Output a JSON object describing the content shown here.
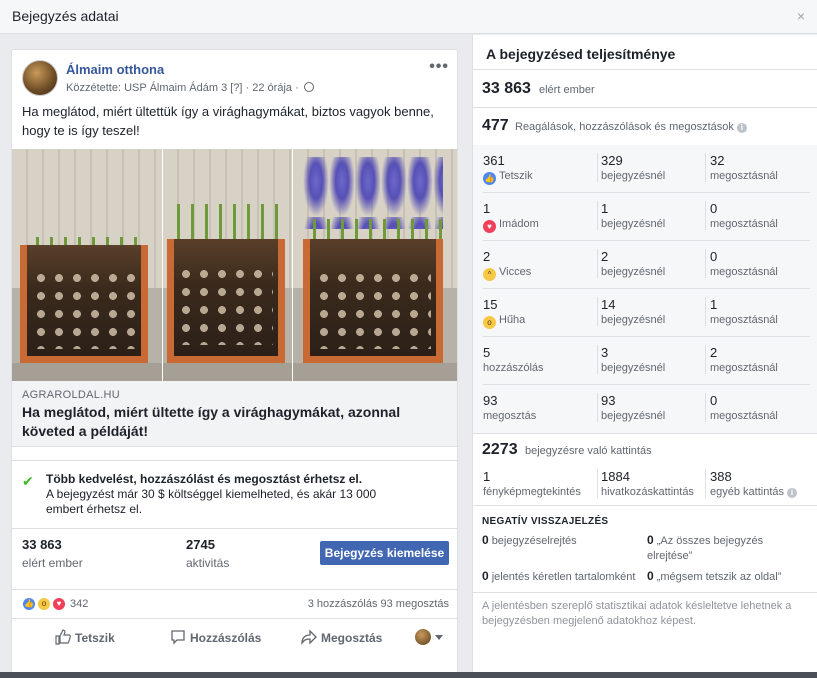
{
  "dialog": {
    "title": "Bejegyzés adatai",
    "close_glyph": "×"
  },
  "post": {
    "page_name": "Álmaim otthona",
    "meta": "Közzétette: USP Álmaim Ádám 3 [?] · 22 órája ·",
    "text": "Ha meglátod, miért ültettük így a virághagymákat, biztos vagyok benne, hogy te is így teszel!",
    "link_domain": "AGRAROLDAL.HU",
    "link_title": "Ha meglátod, miért ültette így a virághagymákat, azonnal követed a példáját!",
    "boost_title": "Több kedvelést, hozzászólást és megosztást érhetsz el.",
    "boost_desc": "A bejegyzést már 30 $ költséggel kiemelheted, és akár 13 000 embert érhetsz el.",
    "reach_value": "33 863",
    "reach_label": "elért ember",
    "activity_value": "2745",
    "activity_label": "aktivitás",
    "boost_button": "Bejegyzés kiemelése",
    "reaction_count": "342",
    "comments_shares": "3 hozzászólás  93 megosztás",
    "actions": {
      "like": "Tetszik",
      "comment": "Hozzászólás",
      "share": "Megosztás"
    }
  },
  "panel": {
    "title": "A bejegyzésed teljesítménye",
    "reach_value": "33 863",
    "reach_label": "elért ember",
    "engagement_value": "477",
    "engagement_label": "Reagálások, hozzászólások és megosztások",
    "rows": [
      {
        "n1": "361",
        "l1": "Tetszik",
        "n2": "329",
        "l2": "bejegyzésnél",
        "n3": "32",
        "l3": "megosztásnál",
        "icon": "like-icon",
        "color": "#4b88f7"
      },
      {
        "n1": "1",
        "l1": "Imádom",
        "n2": "1",
        "l2": "bejegyzésnél",
        "n3": "0",
        "l3": "megosztásnál",
        "icon": "love-icon",
        "color": "#f0405a"
      },
      {
        "n1": "2",
        "l1": "Vicces",
        "n2": "2",
        "l2": "bejegyzésnél",
        "n3": "0",
        "l3": "megosztásnál",
        "icon": "haha-icon",
        "color": "#f7c845"
      },
      {
        "n1": "15",
        "l1": "Hűha",
        "n2": "14",
        "l2": "bejegyzésnél",
        "n3": "1",
        "l3": "megosztásnál",
        "icon": "wow-icon",
        "color": "#f7c845"
      },
      {
        "n1": "5",
        "l1": "hozzászólás",
        "n2": "3",
        "l2": "bejegyzésnél",
        "n3": "2",
        "l3": "megosztásnál"
      },
      {
        "n1": "93",
        "l1": "megosztás",
        "n2": "93",
        "l2": "bejegyzésnél",
        "n3": "0",
        "l3": "megosztásnál"
      }
    ],
    "clicks_value": "2273",
    "clicks_label": "bejegyzésre való kattintás",
    "clicks": [
      {
        "n": "1",
        "l": "fényképmegtekintés"
      },
      {
        "n": "1884",
        "l": "hivatkozáskattintás"
      },
      {
        "n": "388",
        "l": "egyéb kattintás"
      }
    ],
    "negative_title": "NEGATÍV VISSZAJELZÉS",
    "negative": [
      {
        "n": "0",
        "l": "bejegyzéselrejtés"
      },
      {
        "n": "0",
        "l": "„Az összes bejegyzés elrejtése”"
      },
      {
        "n": "0",
        "l": "jelentés kéretlen tartalomként"
      },
      {
        "n": "0",
        "l": "„mégsem tetszik az oldal”"
      }
    ],
    "footnote": "A jelentésben szereplő statisztikai adatok késleltetve lehetnek a bejegyzésben megjelenő adatokhoz képest."
  }
}
